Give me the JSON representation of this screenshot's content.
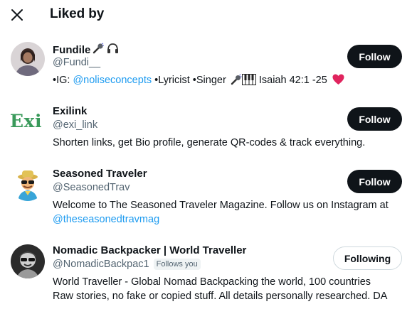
{
  "header": {
    "title": "Liked by"
  },
  "users": [
    {
      "name": "Fundile",
      "handle": "@Fundi__",
      "button": "Follow",
      "bio": {
        "prefix": "•IG: ",
        "link": "@noliseconcepts",
        "middle": " •Lyricist •Singer ",
        "suffix": " Isaiah 42:1 -25 "
      }
    },
    {
      "name": "Exilink",
      "handle": "@exi_link",
      "button": "Follow",
      "avatar_text": "Exi",
      "bio": "Shorten links, get Bio profile, generate QR-codes & track everything."
    },
    {
      "name": "Seasoned Traveler",
      "handle": "@SeasonedTrav",
      "button": "Follow",
      "bio_line1": "Welcome to The Seasoned Traveler Magazine. Follow us on Instagram at",
      "bio_link": "@theseasonedtravmag"
    },
    {
      "name": "Nomadic Backpacker | World Traveller",
      "handle": "@NomadicBackpac1",
      "badge": "Follows you",
      "button": "Following",
      "bio_line1": "World Traveller - Global Nomad Backpacking the world, 100 countries",
      "bio_line2": "Raw stories, no fake or copied stuff. All details personally researched. DA"
    }
  ],
  "colors": {
    "link": "#1d9bf0",
    "exilink_green": "#3a9a5b",
    "heart": "#e0245e",
    "button_dark": "#0f1419"
  }
}
